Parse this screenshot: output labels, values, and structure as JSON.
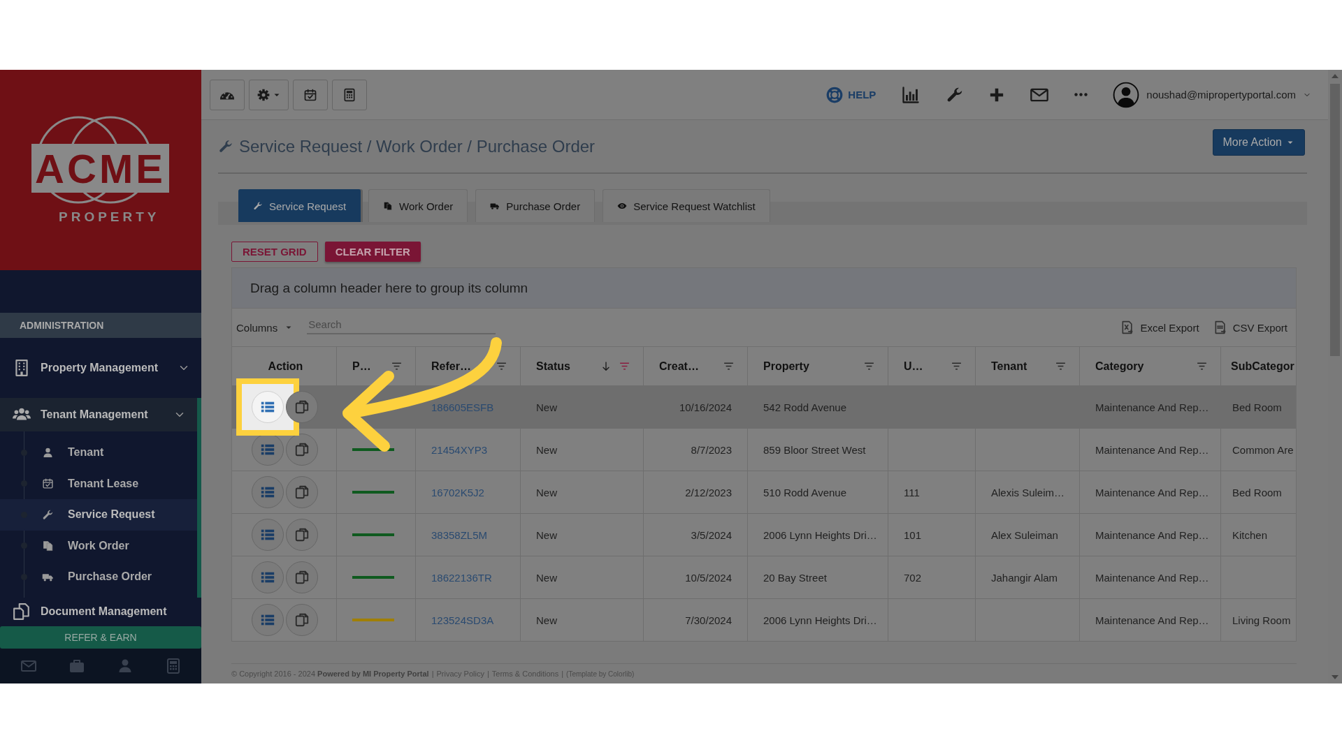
{
  "logo": {
    "wordmark": "ACME",
    "tagline": "PROPERTY"
  },
  "sidebar": {
    "section": "ADMINISTRATION",
    "items": [
      {
        "label": "Property Management",
        "expanded": false
      },
      {
        "label": "Tenant Management",
        "expanded": true,
        "children": [
          {
            "label": "Tenant",
            "selected": false
          },
          {
            "label": "Tenant Lease",
            "selected": false
          },
          {
            "label": "Service Request",
            "selected": true
          },
          {
            "label": "Work Order",
            "selected": false
          },
          {
            "label": "Purchase Order",
            "selected": false
          }
        ]
      },
      {
        "label": "Document Management"
      }
    ],
    "refer_button": "REFER & EARN"
  },
  "topbar": {
    "help": "HELP",
    "user": "noushad@mipropertyportal.com"
  },
  "page": {
    "title": "Service Request / Work Order / Purchase Order",
    "more_action": "More Action"
  },
  "tabs": [
    {
      "label": "Service Request",
      "selected": true
    },
    {
      "label": "Work Order",
      "selected": false
    },
    {
      "label": "Purchase Order",
      "selected": false
    },
    {
      "label": "Service Request Watchlist",
      "selected": false
    }
  ],
  "grid": {
    "buttons": [
      {
        "label": "RESET GRID",
        "kind": "outline"
      },
      {
        "label": "CLEAR FILTER",
        "kind": "filled"
      }
    ],
    "group_hint": "Drag a column header here to group its column",
    "columns_menu": "Columns",
    "search": {
      "placeholder": "Search"
    },
    "exports": [
      "Excel Export",
      "CSV Export"
    ],
    "columns": [
      {
        "label": "Action",
        "filterable": false,
        "sorted_descending": false
      },
      {
        "label": "P…",
        "filterable": true,
        "filter_active": false,
        "sorted_descending": false
      },
      {
        "label": "Refer…",
        "filterable": true,
        "filter_active": false,
        "sorted_descending": false
      },
      {
        "label": "Status",
        "filterable": true,
        "filter_active": true,
        "sorted_descending": true
      },
      {
        "label": "Creat…",
        "filterable": true,
        "filter_active": false,
        "sorted_descending": false
      },
      {
        "label": "Property",
        "filterable": true,
        "filter_active": false,
        "sorted_descending": false
      },
      {
        "label": "U…",
        "filterable": true,
        "filter_active": false,
        "sorted_descending": false
      },
      {
        "label": "Tenant",
        "filterable": true,
        "filter_active": false,
        "sorted_descending": false
      },
      {
        "label": "Category",
        "filterable": true,
        "filter_active": false,
        "sorted_descending": false
      },
      {
        "label": "SubCategor",
        "filterable": false,
        "sorted_descending": false
      }
    ],
    "rows": [
      {
        "highlighted": true,
        "reference": "186605ESFB",
        "status": "New",
        "created": "10/16/2024",
        "property": "542 Rodd Avenue",
        "category": "Maintenance And Rep…",
        "subcategory": "Bed Room"
      },
      {
        "highlighted": false,
        "color": "#0f5a1f",
        "reference": "21454XYP3",
        "status": "New",
        "created": "8/7/2023",
        "property": "859 Bloor Street West",
        "category": "Maintenance And Rep…",
        "subcategory": "Common Are"
      },
      {
        "highlighted": false,
        "color": "#0f5a1f",
        "reference": "16702K5J2",
        "status": "New",
        "created": "2/12/2023",
        "property": "510 Rodd Avenue",
        "unit": "111",
        "tenant": "Alexis Suleim…",
        "category": "Maintenance And Rep…",
        "subcategory": "Bed Room"
      },
      {
        "highlighted": false,
        "color": "#0f5a1f",
        "reference": "38358ZL5M",
        "status": "New",
        "created": "3/5/2024",
        "property": "2006 Lynn Heights Dri…",
        "unit": "101",
        "tenant": "Alex Suleiman",
        "category": "Maintenance And Rep…",
        "subcategory": "Kitchen"
      },
      {
        "highlighted": false,
        "color": "#0f5a1f",
        "reference": "18622136TR",
        "status": "New",
        "created": "10/5/2024",
        "property": "20 Bay Street",
        "unit": "702",
        "tenant": "Jahangir Alam",
        "category": "Maintenance And Rep…"
      },
      {
        "highlighted": false,
        "color": "#a07f00",
        "reference": "123524SD3A",
        "status": "New",
        "created": "7/30/2024",
        "property": "2006 Lynn Heights Dri…",
        "category": "Maintenance And Rep…",
        "subcategory": "Living Room"
      }
    ]
  },
  "footer": [
    {
      "kind": "text",
      "text": "© Copyright 2016 - 2024 **Powered by MI Property Portal**"
    },
    {
      "kind": "separator",
      "text": "|"
    },
    {
      "kind": "link",
      "text": "Privacy Policy"
    },
    {
      "kind": "separator",
      "text": "|"
    },
    {
      "kind": "link",
      "text": "Terms & Conditions"
    },
    {
      "kind": "separator",
      "text": "|"
    },
    {
      "kind": "small",
      "text": "(Template by Colorlib)"
    }
  ]
}
